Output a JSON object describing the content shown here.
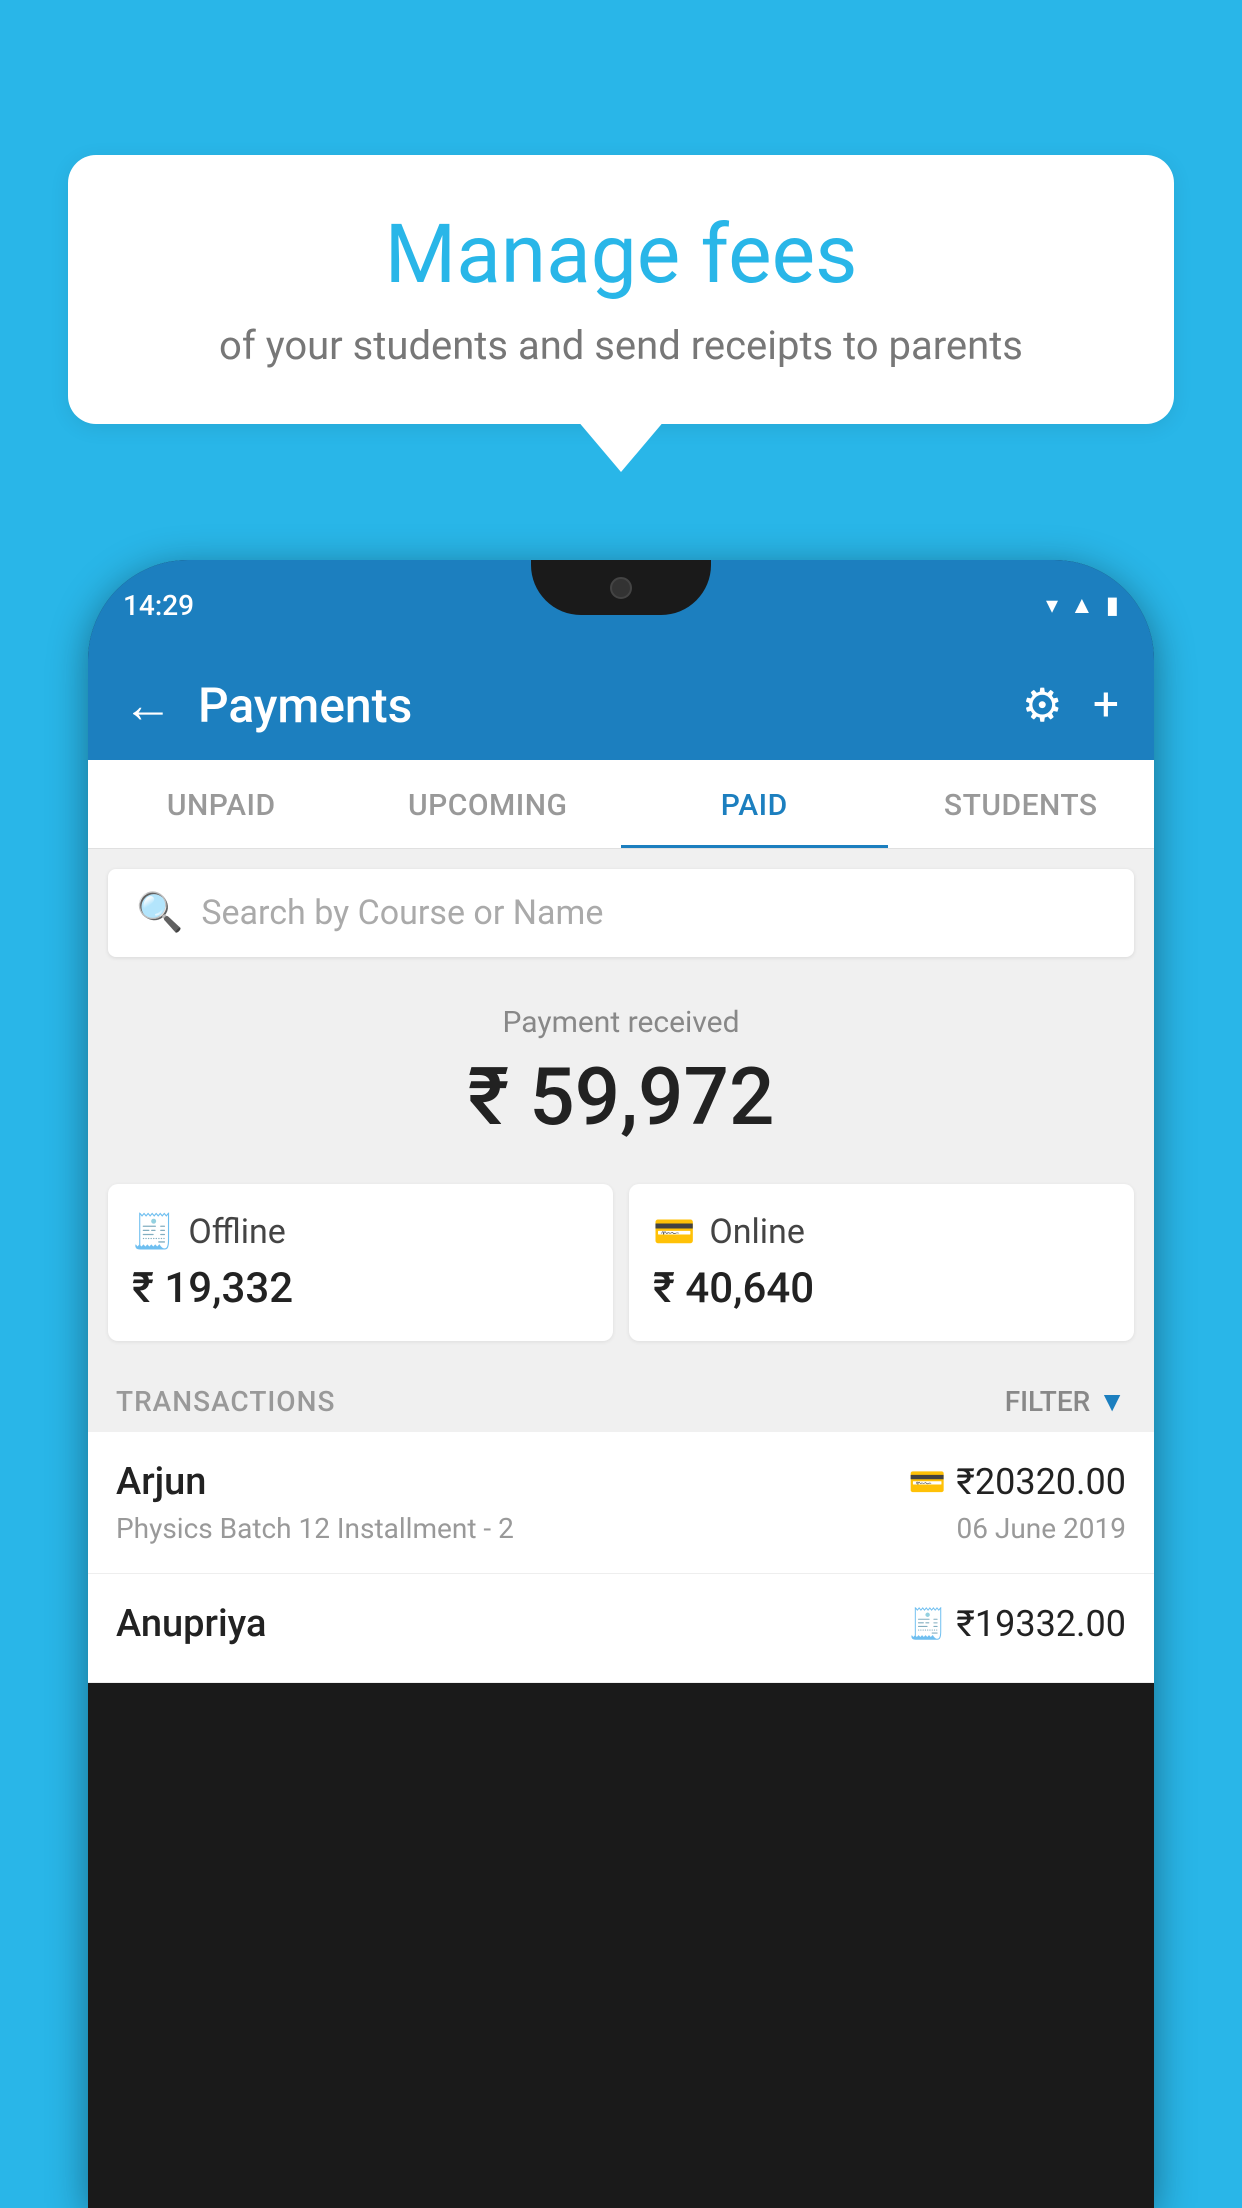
{
  "background_color": "#29b6e8",
  "bubble": {
    "title": "Manage fees",
    "subtitle": "of your students and send receipts to parents"
  },
  "status_bar": {
    "time": "14:29",
    "icons": [
      "wifi",
      "signal",
      "battery"
    ]
  },
  "header": {
    "title": "Payments",
    "back_label": "←",
    "settings_label": "⚙",
    "add_label": "+"
  },
  "tabs": [
    {
      "label": "UNPAID",
      "active": false
    },
    {
      "label": "UPCOMING",
      "active": false
    },
    {
      "label": "PAID",
      "active": true
    },
    {
      "label": "STUDENTS",
      "active": false
    }
  ],
  "search": {
    "placeholder": "Search by Course or Name"
  },
  "payment_summary": {
    "label": "Payment received",
    "amount": "₹ 59,972",
    "offline": {
      "icon": "💳",
      "label": "Offline",
      "amount": "₹ 19,332"
    },
    "online": {
      "icon": "💳",
      "label": "Online",
      "amount": "₹ 40,640"
    }
  },
  "transactions": {
    "section_label": "TRANSACTIONS",
    "filter_label": "FILTER",
    "rows": [
      {
        "name": "Arjun",
        "description": "Physics Batch 12 Installment - 2",
        "date": "06 June 2019",
        "amount": "₹20320.00",
        "icon": "card"
      },
      {
        "name": "Anupriya",
        "description": "",
        "date": "",
        "amount": "₹19332.00",
        "icon": "cash"
      }
    ]
  }
}
